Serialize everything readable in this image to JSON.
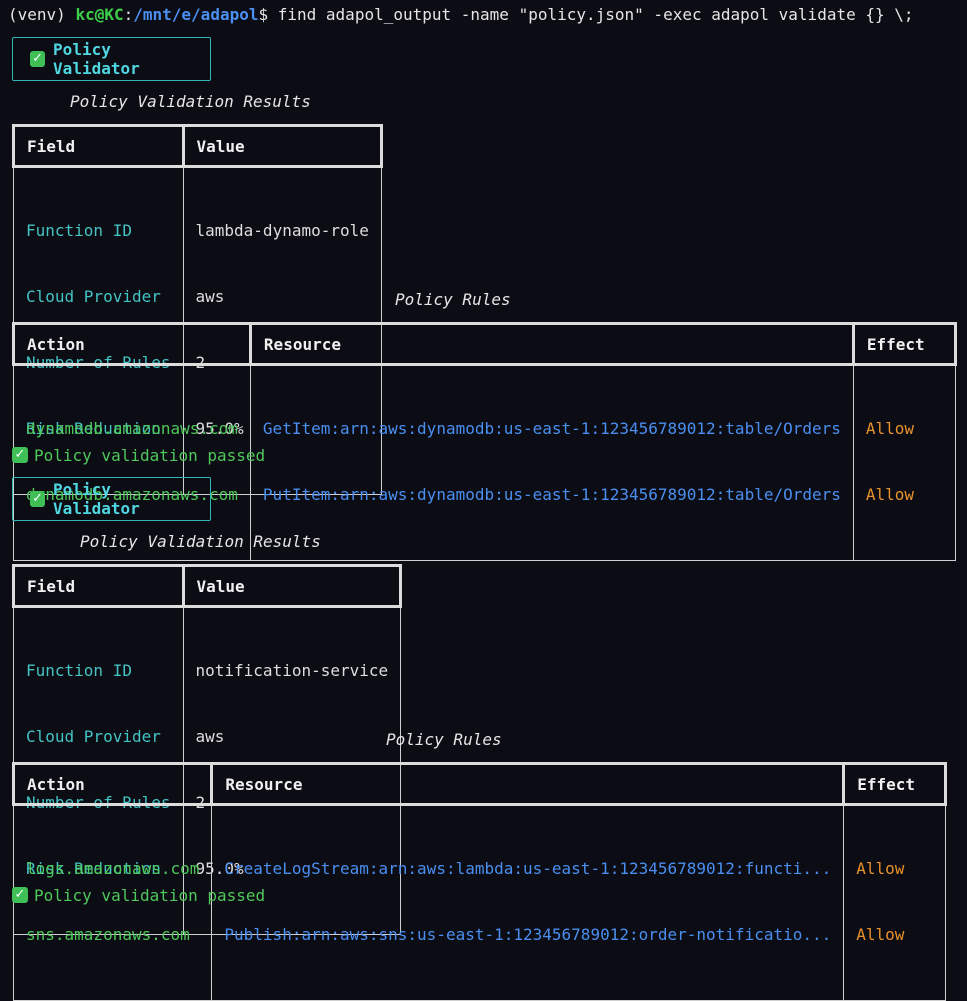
{
  "command_line": {
    "venv": "(venv) ",
    "user": "kc@KC",
    "sep": ":",
    "path": "/mnt/e/adapol",
    "dollar": "$ ",
    "command": "find adapol_output -name \"policy.json\" -exec adapol validate {} \\;"
  },
  "icons": {
    "check": "check-icon",
    "check_color": "#3fbf55"
  },
  "blocks": [
    {
      "validator_label": "Policy Validator",
      "results_title": "Policy Validation Results",
      "results_headers": {
        "field": "Field",
        "value": "Value"
      },
      "results_rows": [
        {
          "field": "Function ID",
          "value": "lambda-dynamo-role"
        },
        {
          "field": "Cloud Provider",
          "value": "aws"
        },
        {
          "field": "Number of Rules",
          "value": "2"
        },
        {
          "field": "Risk Reduction",
          "value": "95.0%"
        }
      ],
      "rules_title": "Policy Rules",
      "rules_headers": {
        "action": "Action",
        "resource": "Resource",
        "effect": "Effect"
      },
      "rules_rows": [
        {
          "action": "dynamodb.amazonaws.com",
          "resource": "GetItem:arn:aws:dynamodb:us-east-1:123456789012:table/Orders",
          "effect": "Allow"
        },
        {
          "action": "dynamodb.amazonaws.com",
          "resource": "PutItem:arn:aws:dynamodb:us-east-1:123456789012:table/Orders",
          "effect": "Allow"
        }
      ],
      "status": "Policy validation passed"
    },
    {
      "validator_label": "Policy Validator",
      "results_title": "Policy Validation Results",
      "results_headers": {
        "field": "Field",
        "value": "Value"
      },
      "results_rows": [
        {
          "field": "Function ID",
          "value": "notification-service"
        },
        {
          "field": "Cloud Provider",
          "value": "aws"
        },
        {
          "field": "Number of Rules",
          "value": "2"
        },
        {
          "field": "Risk Reduction",
          "value": "95.0%"
        }
      ],
      "rules_title": "Policy Rules",
      "rules_headers": {
        "action": "Action",
        "resource": "Resource",
        "effect": "Effect"
      },
      "rules_rows": [
        {
          "action": "logs.amazonaws.com",
          "resource": "CreateLogStream:arn:aws:lambda:us-east-1:123456789012:functi...",
          "effect": "Allow"
        },
        {
          "action": "sns.amazonaws.com",
          "resource": "Publish:arn:aws:sns:us-east-1:123456789012:order-notificatio...",
          "effect": "Allow"
        }
      ],
      "status": "Policy validation passed"
    }
  ],
  "colors": {
    "background": "#0c0c14",
    "user": "#3ecf4a",
    "path": "#4a8ff0",
    "field": "#43c3c3",
    "action": "#4fc85a",
    "resource": "#4a8ff0",
    "effect": "#e8912c",
    "validator_border": "#2fb8b8"
  }
}
